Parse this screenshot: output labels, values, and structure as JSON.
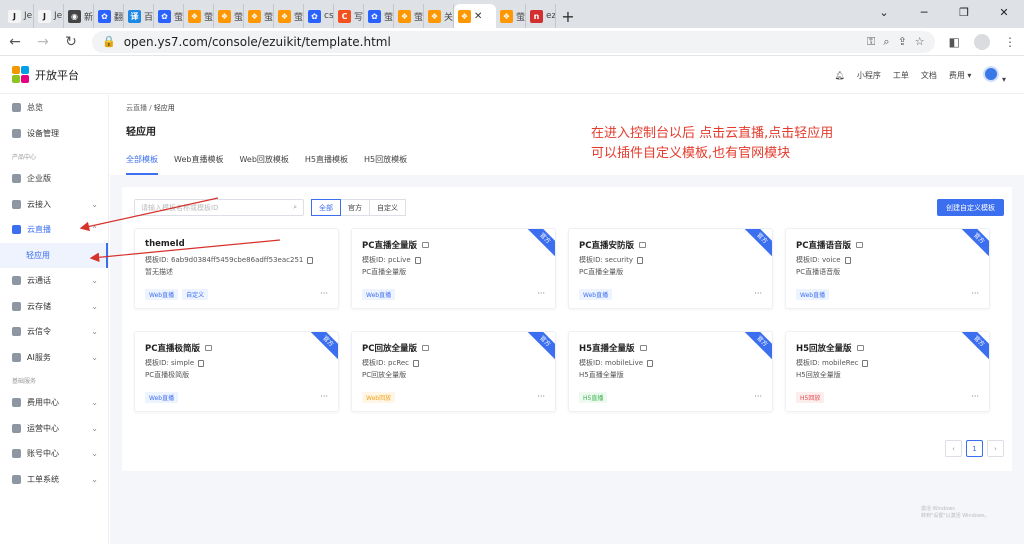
{
  "browser": {
    "tabs": [
      {
        "label": "Je",
        "color": "#f4f4f4",
        "glyph": "J",
        "fg": "#222"
      },
      {
        "label": "Je",
        "color": "#f4f4f4",
        "glyph": "J",
        "fg": "#222"
      },
      {
        "label": "新",
        "color": "#444",
        "glyph": "◉",
        "fg": "#fff"
      },
      {
        "label": "翻",
        "color": "#2962ff",
        "glyph": "✿",
        "fg": "#fff"
      },
      {
        "label": "百",
        "color": "#1e88e5",
        "glyph": "译",
        "fg": "#fff"
      },
      {
        "label": "萤",
        "color": "#2962ff",
        "glyph": "✿",
        "fg": "#fff"
      },
      {
        "label": "萤",
        "color": "#ff9800",
        "glyph": "❖",
        "fg": "#fff"
      },
      {
        "label": "萤",
        "color": "#ff9800",
        "glyph": "❖",
        "fg": "#fff"
      },
      {
        "label": "萤",
        "color": "#ff9800",
        "glyph": "❖",
        "fg": "#fff"
      },
      {
        "label": "萤",
        "color": "#ff9800",
        "glyph": "❖",
        "fg": "#fff"
      },
      {
        "label": "cs",
        "color": "#2962ff",
        "glyph": "✿",
        "fg": "#fff"
      },
      {
        "label": "写",
        "color": "#f4511e",
        "glyph": "C",
        "fg": "#fff"
      },
      {
        "label": "萤",
        "color": "#2962ff",
        "glyph": "✿",
        "fg": "#fff"
      },
      {
        "label": "萤",
        "color": "#ff9800",
        "glyph": "❖",
        "fg": "#fff"
      },
      {
        "label": "关",
        "color": "#ff9800",
        "glyph": "❖",
        "fg": "#fff"
      },
      {
        "label": "",
        "color": "#ff9800",
        "glyph": "❖",
        "fg": "#fff",
        "active": true
      },
      {
        "label": "萤",
        "color": "#ff9800",
        "glyph": "❖",
        "fg": "#fff"
      },
      {
        "label": "ez",
        "color": "#d32f2f",
        "glyph": "n",
        "fg": "#fff"
      }
    ],
    "url": "open.ys7.com/console/ezuikit/template.html"
  },
  "header": {
    "logo_text": "开放平台",
    "links": [
      "小程序",
      "工单",
      "文档",
      "费用"
    ]
  },
  "sidebar": {
    "items": [
      {
        "label": "总览"
      },
      {
        "label": "设备管理"
      },
      {
        "group": "产品中心"
      },
      {
        "label": "企业版"
      },
      {
        "label": "云接入",
        "chev": "⌄"
      },
      {
        "label": "云直播",
        "chev": "⌃",
        "active": true
      },
      {
        "label": "轻应用",
        "sub": true
      },
      {
        "label": "云通话",
        "chev": "⌄"
      },
      {
        "label": "云存储",
        "chev": "⌄"
      },
      {
        "label": "云信令",
        "chev": "⌄"
      },
      {
        "label": "AI服务",
        "chev": "⌄"
      },
      {
        "group": "基础服务"
      },
      {
        "label": "费用中心",
        "chev": "⌄"
      },
      {
        "label": "运营中心",
        "chev": "⌄"
      },
      {
        "label": "账号中心",
        "chev": "⌄"
      },
      {
        "label": "工单系统",
        "chev": "⌄"
      }
    ]
  },
  "main": {
    "breadcrumb_parent": "云直播",
    "breadcrumb_sep": " / ",
    "breadcrumb_current": "轻应用",
    "title": "轻应用",
    "tabs": [
      "全部模板",
      "Web直播模板",
      "Web回放模板",
      "H5直播模板",
      "H5回放模板"
    ],
    "search_placeholder": "请输入模板名称或模板ID",
    "filters": [
      "全部",
      "官方",
      "自定义"
    ],
    "create_label": "创建自定义模板",
    "annotation_line1": "在进入控制台以后 点击云直播,点击轻应用",
    "annotation_line2": "可以插件自定义模板,也有官网模块",
    "ribbon_label": "官方",
    "more_label": "···",
    "cards": [
      {
        "title": "themeId",
        "id": "模板ID: 6ab9d0384ff5459cbe86adff53eac251",
        "desc": "暂无描述",
        "tags": [
          {
            "t": "Web直播",
            "c": "blue"
          },
          {
            "t": "自定义",
            "c": "blue"
          }
        ],
        "official": false,
        "img": false
      },
      {
        "title": "PC直播全量版",
        "id": "模板ID: pcLive",
        "desc": "PC直播全量版",
        "tags": [
          {
            "t": "Web直播",
            "c": "blue"
          }
        ],
        "official": true,
        "img": true
      },
      {
        "title": "PC直播安防版",
        "id": "模板ID: security",
        "desc": "PC直播全量版",
        "tags": [
          {
            "t": "Web直播",
            "c": "blue"
          }
        ],
        "official": true,
        "img": true
      },
      {
        "title": "PC直播语音版",
        "id": "模板ID: voice",
        "desc": "PC直播语音版",
        "tags": [
          {
            "t": "Web直播",
            "c": "blue"
          }
        ],
        "official": true,
        "img": true
      },
      {
        "title": "PC直播极简版",
        "id": "模板ID: simple",
        "desc": "PC直播极简版",
        "tags": [
          {
            "t": "Web直播",
            "c": "blue"
          }
        ],
        "official": true,
        "img": true
      },
      {
        "title": "PC回放全量版",
        "id": "模板ID: pcRec",
        "desc": "PC回放全量版",
        "tags": [
          {
            "t": "Web回放",
            "c": "yellow"
          }
        ],
        "official": true,
        "img": true
      },
      {
        "title": "H5直播全量版",
        "id": "模板ID: mobileLive",
        "desc": "H5直播全量版",
        "tags": [
          {
            "t": "H5直播",
            "c": "green"
          }
        ],
        "official": true,
        "img": true
      },
      {
        "title": "H5回放全量版",
        "id": "模板ID: mobileRec",
        "desc": "H5回放全量版",
        "tags": [
          {
            "t": "H5回放",
            "c": "red"
          }
        ],
        "official": true,
        "img": true
      }
    ],
    "pager": {
      "prev": "‹",
      "page": "1",
      "next": "›"
    },
    "watermark_line1": "激活 Windows",
    "watermark_line2": "转到\"设置\"以激活 Windows。"
  }
}
